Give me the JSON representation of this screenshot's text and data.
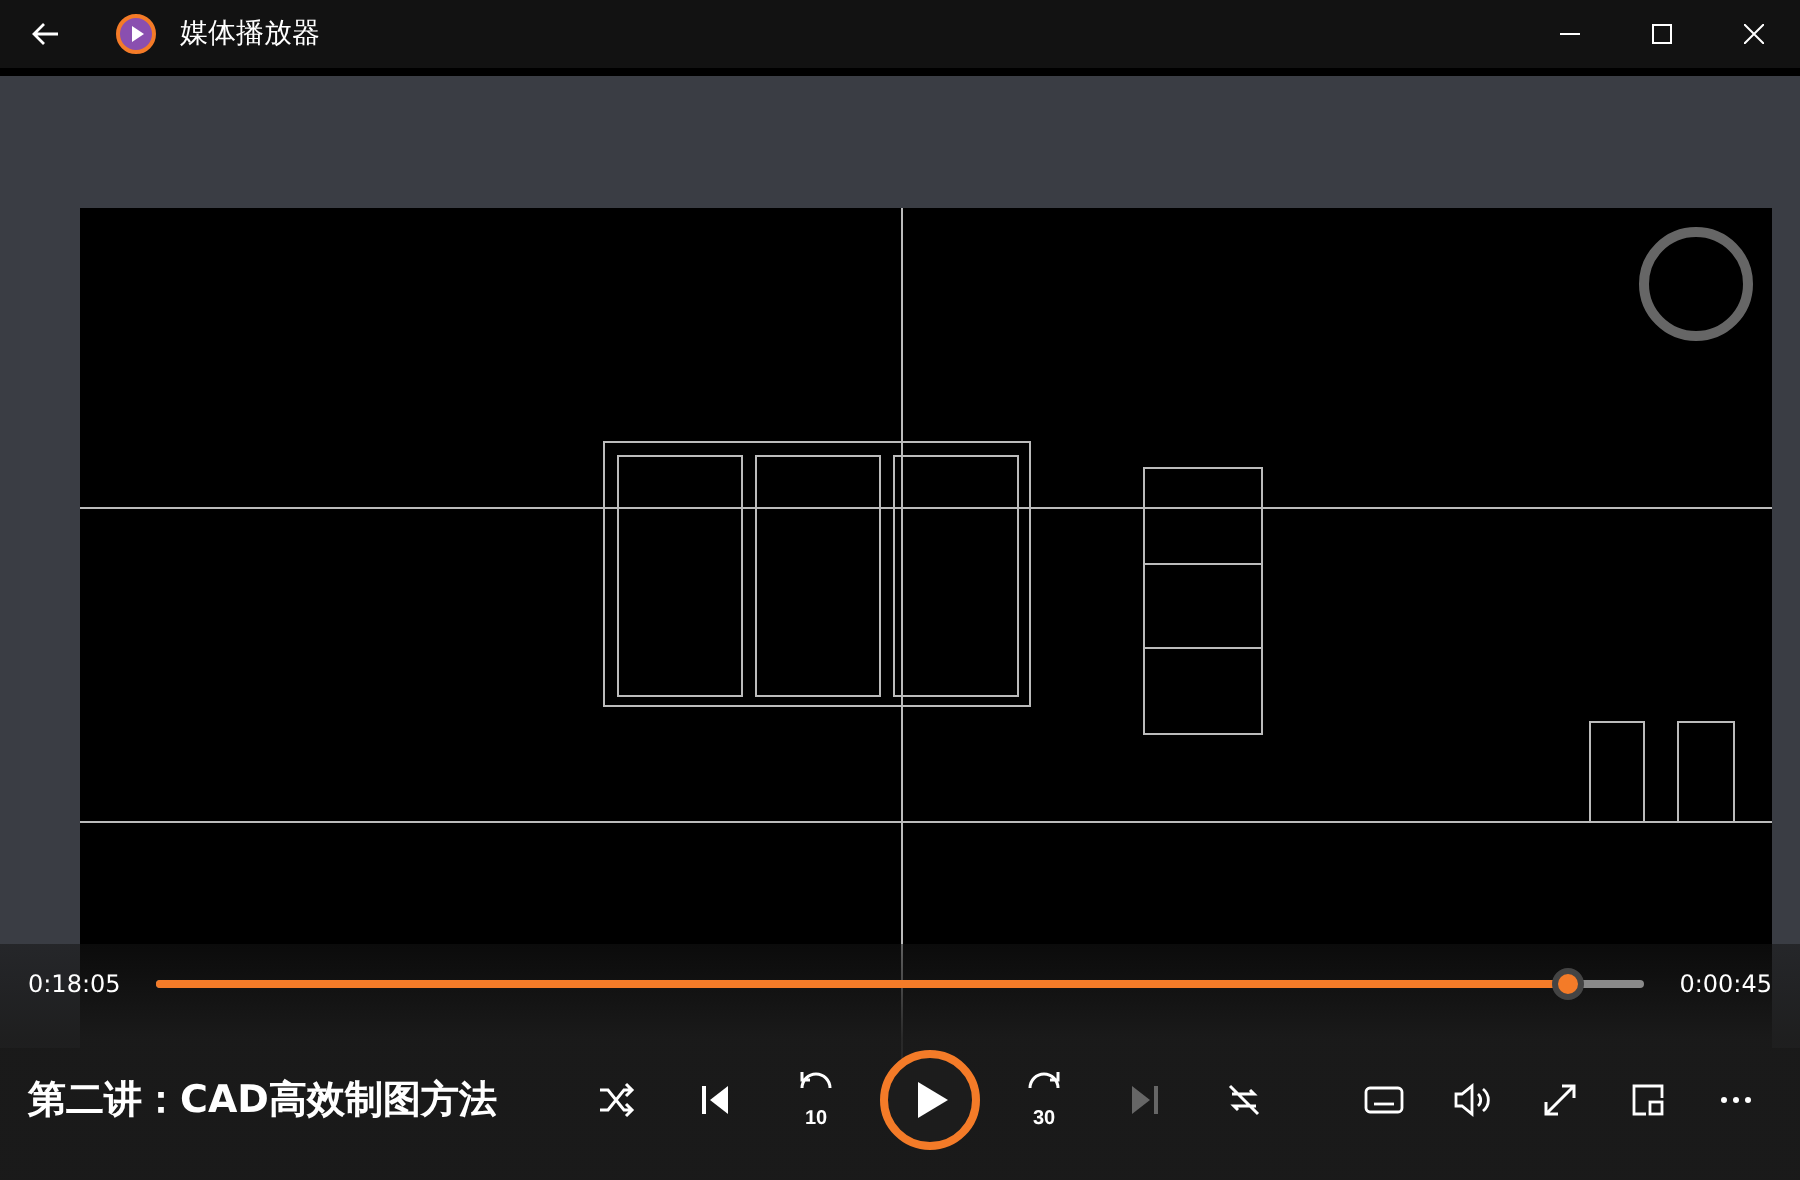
{
  "window": {
    "title": "媒体播放器"
  },
  "seek": {
    "elapsed": "0:18:05",
    "remaining": "0:00:45",
    "level": 0.949
  },
  "media_title": "第二讲：CAD高效制图方法",
  "controls": {
    "rewind_label": "10",
    "forward_label": "30",
    "playing": false,
    "next_disabled": true
  }
}
